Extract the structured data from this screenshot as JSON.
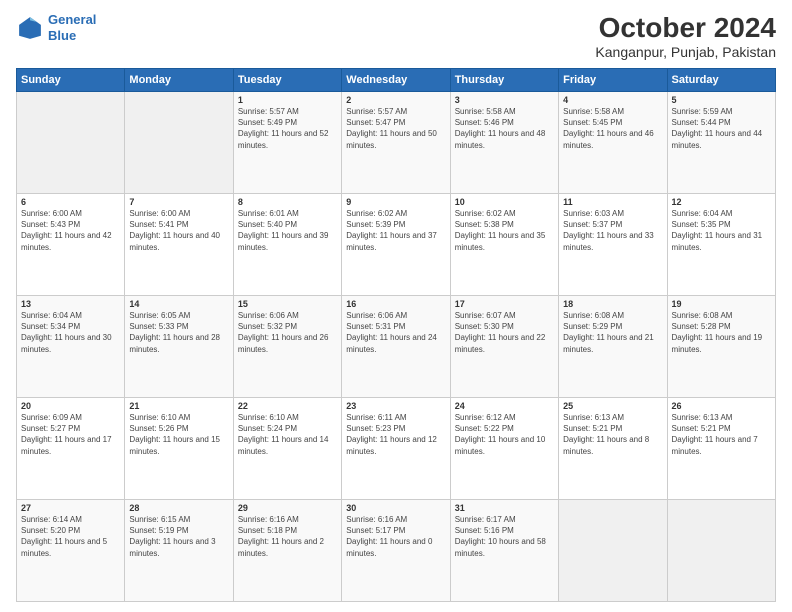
{
  "header": {
    "logo_line1": "General",
    "logo_line2": "Blue",
    "title": "October 2024",
    "subtitle": "Kanganpur, Punjab, Pakistan"
  },
  "weekdays": [
    "Sunday",
    "Monday",
    "Tuesday",
    "Wednesday",
    "Thursday",
    "Friday",
    "Saturday"
  ],
  "weeks": [
    [
      {
        "day": "",
        "info": ""
      },
      {
        "day": "",
        "info": ""
      },
      {
        "day": "1",
        "info": "Sunrise: 5:57 AM\nSunset: 5:49 PM\nDaylight: 11 hours and 52 minutes."
      },
      {
        "day": "2",
        "info": "Sunrise: 5:57 AM\nSunset: 5:47 PM\nDaylight: 11 hours and 50 minutes."
      },
      {
        "day": "3",
        "info": "Sunrise: 5:58 AM\nSunset: 5:46 PM\nDaylight: 11 hours and 48 minutes."
      },
      {
        "day": "4",
        "info": "Sunrise: 5:58 AM\nSunset: 5:45 PM\nDaylight: 11 hours and 46 minutes."
      },
      {
        "day": "5",
        "info": "Sunrise: 5:59 AM\nSunset: 5:44 PM\nDaylight: 11 hours and 44 minutes."
      }
    ],
    [
      {
        "day": "6",
        "info": "Sunrise: 6:00 AM\nSunset: 5:43 PM\nDaylight: 11 hours and 42 minutes."
      },
      {
        "day": "7",
        "info": "Sunrise: 6:00 AM\nSunset: 5:41 PM\nDaylight: 11 hours and 40 minutes."
      },
      {
        "day": "8",
        "info": "Sunrise: 6:01 AM\nSunset: 5:40 PM\nDaylight: 11 hours and 39 minutes."
      },
      {
        "day": "9",
        "info": "Sunrise: 6:02 AM\nSunset: 5:39 PM\nDaylight: 11 hours and 37 minutes."
      },
      {
        "day": "10",
        "info": "Sunrise: 6:02 AM\nSunset: 5:38 PM\nDaylight: 11 hours and 35 minutes."
      },
      {
        "day": "11",
        "info": "Sunrise: 6:03 AM\nSunset: 5:37 PM\nDaylight: 11 hours and 33 minutes."
      },
      {
        "day": "12",
        "info": "Sunrise: 6:04 AM\nSunset: 5:35 PM\nDaylight: 11 hours and 31 minutes."
      }
    ],
    [
      {
        "day": "13",
        "info": "Sunrise: 6:04 AM\nSunset: 5:34 PM\nDaylight: 11 hours and 30 minutes."
      },
      {
        "day": "14",
        "info": "Sunrise: 6:05 AM\nSunset: 5:33 PM\nDaylight: 11 hours and 28 minutes."
      },
      {
        "day": "15",
        "info": "Sunrise: 6:06 AM\nSunset: 5:32 PM\nDaylight: 11 hours and 26 minutes."
      },
      {
        "day": "16",
        "info": "Sunrise: 6:06 AM\nSunset: 5:31 PM\nDaylight: 11 hours and 24 minutes."
      },
      {
        "day": "17",
        "info": "Sunrise: 6:07 AM\nSunset: 5:30 PM\nDaylight: 11 hours and 22 minutes."
      },
      {
        "day": "18",
        "info": "Sunrise: 6:08 AM\nSunset: 5:29 PM\nDaylight: 11 hours and 21 minutes."
      },
      {
        "day": "19",
        "info": "Sunrise: 6:08 AM\nSunset: 5:28 PM\nDaylight: 11 hours and 19 minutes."
      }
    ],
    [
      {
        "day": "20",
        "info": "Sunrise: 6:09 AM\nSunset: 5:27 PM\nDaylight: 11 hours and 17 minutes."
      },
      {
        "day": "21",
        "info": "Sunrise: 6:10 AM\nSunset: 5:26 PM\nDaylight: 11 hours and 15 minutes."
      },
      {
        "day": "22",
        "info": "Sunrise: 6:10 AM\nSunset: 5:24 PM\nDaylight: 11 hours and 14 minutes."
      },
      {
        "day": "23",
        "info": "Sunrise: 6:11 AM\nSunset: 5:23 PM\nDaylight: 11 hours and 12 minutes."
      },
      {
        "day": "24",
        "info": "Sunrise: 6:12 AM\nSunset: 5:22 PM\nDaylight: 11 hours and 10 minutes."
      },
      {
        "day": "25",
        "info": "Sunrise: 6:13 AM\nSunset: 5:21 PM\nDaylight: 11 hours and 8 minutes."
      },
      {
        "day": "26",
        "info": "Sunrise: 6:13 AM\nSunset: 5:21 PM\nDaylight: 11 hours and 7 minutes."
      }
    ],
    [
      {
        "day": "27",
        "info": "Sunrise: 6:14 AM\nSunset: 5:20 PM\nDaylight: 11 hours and 5 minutes."
      },
      {
        "day": "28",
        "info": "Sunrise: 6:15 AM\nSunset: 5:19 PM\nDaylight: 11 hours and 3 minutes."
      },
      {
        "day": "29",
        "info": "Sunrise: 6:16 AM\nSunset: 5:18 PM\nDaylight: 11 hours and 2 minutes."
      },
      {
        "day": "30",
        "info": "Sunrise: 6:16 AM\nSunset: 5:17 PM\nDaylight: 11 hours and 0 minutes."
      },
      {
        "day": "31",
        "info": "Sunrise: 6:17 AM\nSunset: 5:16 PM\nDaylight: 10 hours and 58 minutes."
      },
      {
        "day": "",
        "info": ""
      },
      {
        "day": "",
        "info": ""
      }
    ]
  ]
}
